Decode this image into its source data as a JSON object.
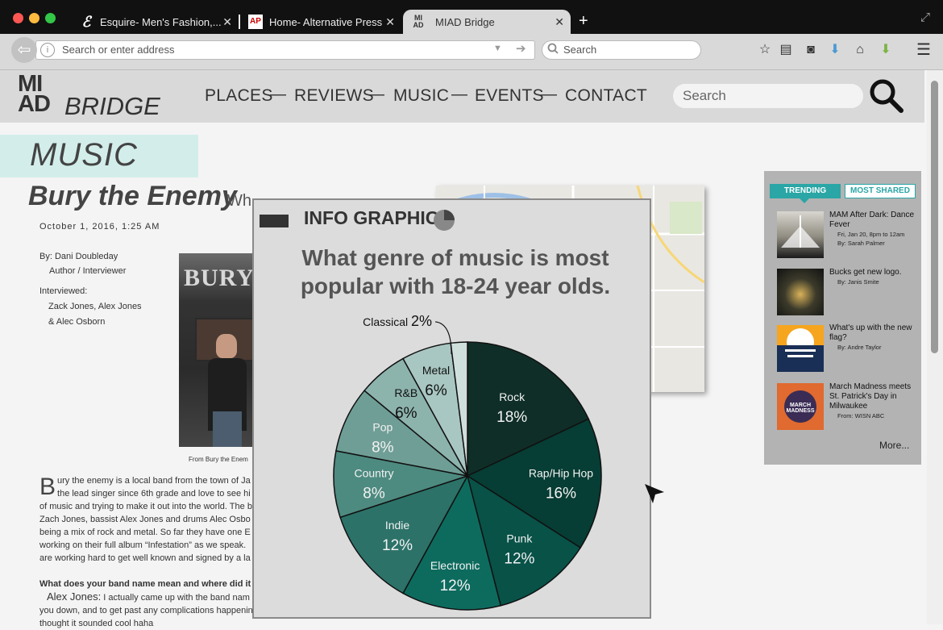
{
  "browser": {
    "tabs": [
      {
        "title": "Esquire- Men's Fashion,...",
        "icon": "esquire-icon"
      },
      {
        "title": "Home- Alternative Press",
        "icon": "ap-icon"
      },
      {
        "title": "MIAD Bridge",
        "icon": "miad-icon"
      }
    ],
    "new_tab": "+",
    "address_placeholder": "Search or enter address",
    "search_placeholder": "Search"
  },
  "site": {
    "logo_top": "MI",
    "logo_bottom": "AD",
    "logo_word": "BRIDGE",
    "nav": [
      "PLACES",
      "REVIEWS",
      "MUSIC",
      "EVENTS",
      "CONTACT"
    ],
    "nav_separator": "—",
    "search_placeholder": "Search"
  },
  "article": {
    "section": "MUSIC",
    "title": "Bury the Enemy",
    "subtitle": "Wh...",
    "date": "October 1, 2016, 1:25 AM",
    "byline": "By: Dani Doubleday",
    "role": "Author / Interviewer",
    "interviewed_label": "Interviewed:",
    "interviewed_names_1": "Zack Jones, Alex Jones",
    "interviewed_names_2": "& Alec Osborn",
    "photo_word": "BURY",
    "photo_caption": "From Bury the Enem",
    "drop_cap": "B",
    "body_lines": [
      "ury the enemy is a local band from the town of Ja",
      "the lead singer since 6th grade and love to see hi",
      "of music and trying to make it out into the world. The ban",
      "Zach Jones, bassist Alex Jones and drums Alec Osbo",
      "being a mix of rock and metal. So far they have one E",
      "working on their full album “Infestation” as we speak.",
      "are working hard to get well known and signed by a la"
    ],
    "question": "What does your band name mean and where did it come",
    "answer_speaker": "Alex Jones:",
    "answer_lines": [
      " I actually came up with the band nam",
      "you down, and to get past any complications happenin",
      "thought it sounded cool haha"
    ]
  },
  "infographic": {
    "label": "INFO GRAPHIC",
    "question": "What genre of music is most popular with 18-24 year olds."
  },
  "chart_data": {
    "type": "pie",
    "title": "What genre of music is most popular with 18-24 year olds.",
    "unit": "%",
    "slices": [
      {
        "label": "Rock",
        "value": 18,
        "color": "#0f2e27"
      },
      {
        "label": "Rap/Hip Hop",
        "value": 16,
        "color": "#063d34"
      },
      {
        "label": "Punk",
        "value": 12,
        "color": "#085248"
      },
      {
        "label": "Electronic",
        "value": 12,
        "color": "#0d6b5e"
      },
      {
        "label": "Indie",
        "value": 12,
        "color": "#2c7268"
      },
      {
        "label": "Country",
        "value": 8,
        "color": "#4d8a80"
      },
      {
        "label": "Pop",
        "value": 8,
        "color": "#6f9e96"
      },
      {
        "label": "R&B",
        "value": 6,
        "color": "#8db3ad"
      },
      {
        "label": "Metal",
        "value": 6,
        "color": "#a9c7c2"
      },
      {
        "label": "Classical",
        "value": 2,
        "color": "#cfdfdc"
      }
    ]
  },
  "trending": {
    "tab_active": "TRENDING",
    "tab_other": "MOST SHARED",
    "items": [
      {
        "title": "MAM After Dark: Dance Fever",
        "detail": "Fri, Jan 20, 8pm to 12am",
        "by": "By: Sarah Palmer"
      },
      {
        "title": "Bucks get new logo.",
        "by": "By: Janis Smite"
      },
      {
        "title": "What's up with the new flag?",
        "by": "By: Andre Taylor"
      },
      {
        "title": "March Madness meets St. Patrick's Day in Milwaukee",
        "by": "From: WISN ABC"
      }
    ],
    "thumb_text": "MARCH MADNESS",
    "more": "More..."
  },
  "colors": {
    "accent_teal": "#2aa6a6",
    "header_bg": "#d9d9d9",
    "music_band": "#d3eeea"
  }
}
